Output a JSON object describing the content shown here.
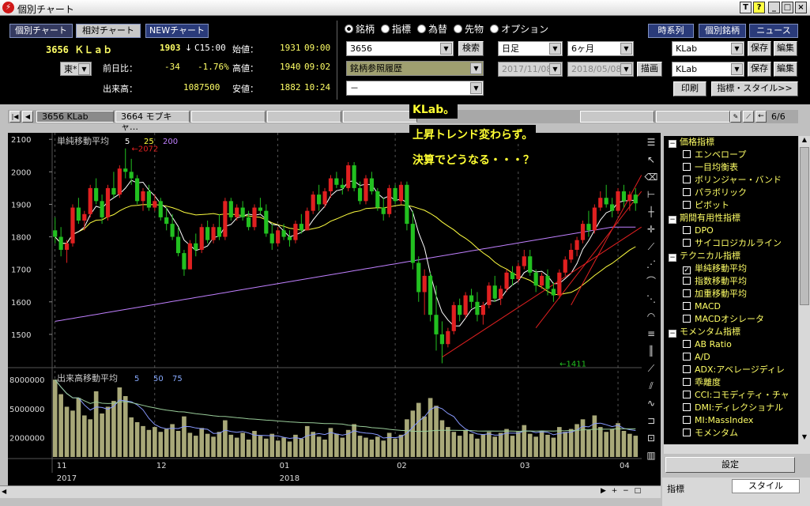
{
  "window": {
    "title": "個別チャート",
    "buttons": [
      "T",
      "?",
      "_",
      "□",
      "×"
    ]
  },
  "nav_buttons": [
    "個別チャート",
    "相対チャート",
    "NEWチャート"
  ],
  "stock": {
    "code_name": "3656 ＫＬａｂ",
    "price": "1903",
    "arrow": "↓",
    "close_time": "C15:00",
    "open_label": "始値：",
    "open": "1931",
    "open_time": "09:00",
    "change_label": "前日比：",
    "change": "-34",
    "change_pct": "-1.76%",
    "high_label": "高値：",
    "high": "1940",
    "high_time": "09:02",
    "volume_label": "出来高：",
    "volume": "1087500",
    "low_label": "安値：",
    "low": "1882",
    "low_time": "10:24",
    "market": "東*"
  },
  "radio_options": [
    {
      "label": "銘柄",
      "selected": true
    },
    {
      "label": "指標",
      "selected": false
    },
    {
      "label": "為替",
      "selected": false
    },
    {
      "label": "先物",
      "selected": false
    },
    {
      "label": "オプション",
      "selected": false
    }
  ],
  "search": {
    "code": "3656",
    "button": "検索",
    "history": "銘柄参照履歴",
    "third": "－"
  },
  "period": {
    "type": "日足",
    "range": "6ヶ月",
    "from": "2017/11/08",
    "to": "2018/05/08",
    "draw": "描画"
  },
  "right_buttons": [
    "時系列",
    "個別銘柄",
    "ニュース"
  ],
  "save_rows": [
    {
      "value": "KLab",
      "save": "保存",
      "edit": "編集"
    },
    {
      "value": "KLab",
      "save": "保存",
      "edit": "編集"
    }
  ],
  "print_button": "印刷",
  "style_button": "指標・スタイル>>",
  "tabs": [
    "3656 KLab",
    "3664 モブキャ…"
  ],
  "page_counter": "6/6",
  "overlay_comments": [
    "KLab。",
    "上昇トレンド変わらず。",
    "決算でどうなる・・・？"
  ],
  "colors": {
    "up": "#e02020",
    "down": "#22c020",
    "ma5": "#ffffff",
    "ma25": "#ffff40",
    "ma200": "#c080ff",
    "trend": "#e02020",
    "accent": "#ffff66"
  },
  "indicator_tree": [
    {
      "group": "価格指標",
      "items": [
        {
          "label": "エンベロープ",
          "checked": false
        },
        {
          "label": "一目均衡表",
          "checked": false
        },
        {
          "label": "ボリンジャー・バンド",
          "checked": false
        },
        {
          "label": "パラボリック",
          "checked": false
        },
        {
          "label": "ピボット",
          "checked": false
        }
      ]
    },
    {
      "group": "期間有用性指標",
      "items": [
        {
          "label": "DPO",
          "checked": false
        },
        {
          "label": "サイコロジカルライン",
          "checked": false
        }
      ]
    },
    {
      "group": "テクニカル指標",
      "items": [
        {
          "label": "単純移動平均",
          "checked": true
        },
        {
          "label": "指数移動平均",
          "checked": false
        },
        {
          "label": "加重移動平均",
          "checked": false
        },
        {
          "label": "MACD",
          "checked": false
        },
        {
          "label": "MACDオシレータ",
          "checked": false
        }
      ]
    },
    {
      "group": "モメンタム指標",
      "items": [
        {
          "label": "AB Ratio",
          "checked": false
        },
        {
          "label": "A/D",
          "checked": false
        },
        {
          "label": "ADX:アベレージディレ",
          "checked": false
        },
        {
          "label": "乖離度",
          "checked": false
        },
        {
          "label": "CCI:コモディティ・チャ",
          "checked": false
        },
        {
          "label": "DMI:ディレクショナル",
          "checked": false
        },
        {
          "label": "MI:MassIndex",
          "checked": false
        },
        {
          "label": "モメンタム",
          "checked": false
        }
      ]
    }
  ],
  "settings_button": "設定",
  "bottom_tabs": [
    "指標",
    "スタイル"
  ],
  "chart_data": [
    {
      "type": "candlestick",
      "title": "単純移動平均",
      "ma_periods": [
        "5",
        "25",
        "200"
      ],
      "ylim": [
        1400,
        2120
      ],
      "y_ticks": [
        "2100",
        "2000",
        "1900",
        "1800",
        "1700",
        "1600",
        "1500"
      ],
      "annotations": [
        {
          "text": "←2072",
          "x_index": 13
        },
        {
          "text": "←1411",
          "x_index": 86
        }
      ],
      "ohlc": [
        [
          1820,
          1860,
          1780,
          1800
        ],
        [
          1800,
          1830,
          1740,
          1760
        ],
        [
          1760,
          1790,
          1720,
          1780
        ],
        [
          1780,
          1900,
          1770,
          1890
        ],
        [
          1890,
          1920,
          1840,
          1850
        ],
        [
          1850,
          1880,
          1820,
          1870
        ],
        [
          1870,
          1960,
          1860,
          1950
        ],
        [
          1950,
          1980,
          1900,
          1910
        ],
        [
          1910,
          1930,
          1840,
          1860
        ],
        [
          1860,
          1960,
          1850,
          1950
        ],
        [
          1950,
          2000,
          1920,
          1930
        ],
        [
          1930,
          2020,
          1920,
          2010
        ],
        [
          2010,
          2072,
          1980,
          2000
        ],
        [
          2000,
          2040,
          1960,
          1980
        ],
        [
          1980,
          1990,
          1900,
          1910
        ],
        [
          1910,
          1950,
          1880,
          1940
        ],
        [
          1940,
          1960,
          1880,
          1890
        ],
        [
          1890,
          1930,
          1880,
          1910
        ],
        [
          1910,
          1920,
          1850,
          1860
        ],
        [
          1860,
          1890,
          1820,
          1840
        ],
        [
          1840,
          1870,
          1790,
          1800
        ],
        [
          1800,
          1830,
          1740,
          1750
        ],
        [
          1750,
          1760,
          1680,
          1700
        ],
        [
          1700,
          1790,
          1700,
          1780
        ],
        [
          1780,
          1810,
          1740,
          1760
        ],
        [
          1760,
          1840,
          1750,
          1830
        ],
        [
          1830,
          1850,
          1780,
          1790
        ],
        [
          1790,
          1840,
          1780,
          1830
        ],
        [
          1830,
          1870,
          1790,
          1800
        ],
        [
          1800,
          1920,
          1790,
          1910
        ],
        [
          1910,
          1920,
          1850,
          1860
        ],
        [
          1860,
          1900,
          1850,
          1890
        ],
        [
          1890,
          1910,
          1850,
          1860
        ],
        [
          1860,
          1880,
          1820,
          1830
        ],
        [
          1830,
          1900,
          1820,
          1890
        ],
        [
          1890,
          1920,
          1870,
          1880
        ],
        [
          1880,
          1900,
          1800,
          1810
        ],
        [
          1810,
          1840,
          1760,
          1780
        ],
        [
          1780,
          1830,
          1770,
          1820
        ],
        [
          1820,
          1840,
          1790,
          1800
        ],
        [
          1800,
          1820,
          1770,
          1790
        ],
        [
          1790,
          1850,
          1780,
          1840
        ],
        [
          1840,
          1870,
          1810,
          1820
        ],
        [
          1820,
          1890,
          1820,
          1880
        ],
        [
          1880,
          1940,
          1870,
          1930
        ],
        [
          1930,
          1960,
          1880,
          1900
        ],
        [
          1900,
          1950,
          1890,
          1940
        ],
        [
          1940,
          1990,
          1920,
          1980
        ],
        [
          1980,
          2000,
          1950,
          1960
        ],
        [
          1960,
          1980,
          1930,
          1950
        ],
        [
          1950,
          2030,
          1940,
          2020
        ],
        [
          2020,
          2030,
          1940,
          1950
        ],
        [
          1950,
          1970,
          1900,
          1910
        ],
        [
          1910,
          1990,
          1900,
          1980
        ],
        [
          1980,
          2000,
          1930,
          1940
        ],
        [
          1940,
          1950,
          1880,
          1890
        ],
        [
          1890,
          1920,
          1850,
          1870
        ],
        [
          1870,
          1960,
          1860,
          1950
        ],
        [
          1950,
          1960,
          1900,
          1910
        ],
        [
          1910,
          1970,
          1900,
          1960
        ],
        [
          1960,
          1970,
          1820,
          1840
        ],
        [
          1840,
          1880,
          1700,
          1720
        ],
        [
          1720,
          1740,
          1600,
          1630
        ],
        [
          1630,
          1700,
          1560,
          1680
        ],
        [
          1680,
          1690,
          1540,
          1560
        ],
        [
          1560,
          1650,
          1450,
          1500
        ],
        [
          1500,
          1540,
          1411,
          1470
        ],
        [
          1470,
          1520,
          1460,
          1510
        ],
        [
          1510,
          1600,
          1500,
          1590
        ],
        [
          1590,
          1610,
          1540,
          1560
        ],
        [
          1560,
          1630,
          1550,
          1620
        ],
        [
          1620,
          1640,
          1580,
          1600
        ],
        [
          1600,
          1630,
          1540,
          1560
        ],
        [
          1560,
          1600,
          1530,
          1590
        ],
        [
          1590,
          1660,
          1580,
          1650
        ],
        [
          1650,
          1680,
          1600,
          1610
        ],
        [
          1610,
          1650,
          1590,
          1640
        ],
        [
          1640,
          1700,
          1630,
          1690
        ],
        [
          1690,
          1710,
          1650,
          1670
        ],
        [
          1670,
          1720,
          1660,
          1710
        ],
        [
          1710,
          1760,
          1700,
          1740
        ],
        [
          1740,
          1760,
          1680,
          1690
        ],
        [
          1690,
          1700,
          1630,
          1650
        ],
        [
          1650,
          1690,
          1640,
          1680
        ],
        [
          1680,
          1700,
          1620,
          1640
        ],
        [
          1640,
          1660,
          1600,
          1620
        ],
        [
          1620,
          1700,
          1610,
          1690
        ],
        [
          1690,
          1740,
          1680,
          1730
        ],
        [
          1730,
          1780,
          1720,
          1760
        ],
        [
          1760,
          1800,
          1740,
          1790
        ],
        [
          1790,
          1850,
          1780,
          1840
        ],
        [
          1840,
          1880,
          1800,
          1820
        ],
        [
          1820,
          1900,
          1810,
          1890
        ],
        [
          1890,
          1940,
          1880,
          1920
        ],
        [
          1920,
          1960,
          1890,
          1900
        ],
        [
          1900,
          1920,
          1860,
          1880
        ],
        [
          1880,
          1950,
          1870,
          1940
        ],
        [
          1940,
          1960,
          1890,
          1910
        ],
        [
          1910,
          1940,
          1880,
          1930
        ],
        [
          1930,
          1950,
          1880,
          1903
        ]
      ]
    },
    {
      "type": "bar",
      "title": "出来高移動平均",
      "ma_periods": [
        "5",
        "50",
        "75"
      ],
      "y_ticks": [
        "8000000",
        "5000000",
        "2000000"
      ],
      "ylim": [
        0,
        9000000
      ],
      "values": [
        8000000,
        6500000,
        5200000,
        4800000,
        6100000,
        4300000,
        3900000,
        6800000,
        4500000,
        5200000,
        5800000,
        7200000,
        6300000,
        4100000,
        3600000,
        3200000,
        2800000,
        3100000,
        2600000,
        2900000,
        3400000,
        2700000,
        4200000,
        2500000,
        2200000,
        3000000,
        2400000,
        2100000,
        2600000,
        3800000,
        2300000,
        2000000,
        2500000,
        1800000,
        2700000,
        2200000,
        1900000,
        2400000,
        1700000,
        2000000,
        1600000,
        2300000,
        1900000,
        3200000,
        2600000,
        2100000,
        1800000,
        3000000,
        2400000,
        2000000,
        2800000,
        3400000,
        2200000,
        2000000,
        1800000,
        2100000,
        1700000,
        2500000,
        1900000,
        2300000,
        3900000,
        4800000,
        5600000,
        4200000,
        6100000,
        5300000,
        3800000,
        3100000,
        2600000,
        2200000,
        2800000,
        2400000,
        1900000,
        2300000,
        2600000,
        2100000,
        2500000,
        2900000,
        2200000,
        2600000,
        3300000,
        2400000,
        2100000,
        2700000,
        2300000,
        2000000,
        3100000,
        2600000,
        2900000,
        3400000,
        3900000,
        2800000,
        4300000,
        3100000,
        2600000,
        2900000,
        3500000,
        2700000,
        2400000,
        2200000
      ],
      "x_tick_labels": [
        "11",
        "12",
        "01",
        "02",
        "03",
        "04"
      ],
      "year_labels": [
        "2017",
        "2018"
      ]
    }
  ]
}
